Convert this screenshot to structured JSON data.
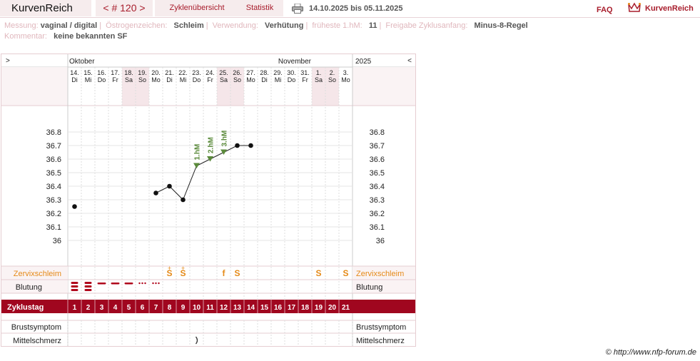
{
  "nav": {
    "brand": "KurvenReich",
    "cycle": "< # 120 >",
    "overview": "Zyklenübersicht",
    "stats": "Statistik",
    "date_range": "14.10.2025 bis 05.11.2025",
    "faq": "FAQ",
    "logo_text": "KurvenReich"
  },
  "info": {
    "messung_label": "Messung:",
    "messung": "vaginal / digital",
    "oestro_label": "Östrogenzeichen:",
    "oestro": "Schleim",
    "verwendung_label": "Verwendung:",
    "verwendung": "Verhütung",
    "frueh_label": "früheste 1.hM:",
    "frueh": "11",
    "freigabe_label": "Freigabe Zyklusanfang:",
    "freigabe": "Minus-8-Regel",
    "kommentar_label": "Kommentar:",
    "kommentar": "keine bekannten SF"
  },
  "chart": {
    "nav_left": ">",
    "nav_right": "<",
    "month1": "Oktober",
    "month2": "November",
    "year": "2025",
    "dates": [
      "14.",
      "15.",
      "16.",
      "17.",
      "18.",
      "19.",
      "20.",
      "21.",
      "22.",
      "23.",
      "24.",
      "25.",
      "26.",
      "27.",
      "28.",
      "29.",
      "30.",
      "31.",
      "1.",
      "2.",
      "3."
    ],
    "weekdays": [
      "Di",
      "Mi",
      "Do",
      "Fr",
      "Sa",
      "So",
      "Mo",
      "Di",
      "Mi",
      "Do",
      "Fr",
      "Sa",
      "So",
      "Mo",
      "Di",
      "Mi",
      "Do",
      "Fr",
      "Sa",
      "So",
      "Mo"
    ],
    "weekend_cols": [
      4,
      5,
      11,
      12,
      18,
      19
    ],
    "y_ticks": [
      "36.8",
      "36.7",
      "36.6",
      "36.5",
      "36.4",
      "36.3",
      "36.2",
      "36.1",
      "36"
    ],
    "temps": [
      36.25,
      null,
      null,
      null,
      null,
      null,
      36.35,
      36.4,
      36.3,
      36.55,
      36.6,
      36.65,
      36.7,
      36.7,
      null,
      null,
      null,
      null,
      null,
      null,
      null
    ],
    "line_segments": [
      [
        6,
        13
      ]
    ],
    "hm_markers": [
      {
        "day": 10,
        "label": "1.hM"
      },
      {
        "day": 11,
        "label": "2.hM"
      },
      {
        "day": 12,
        "label": "3.hM"
      }
    ],
    "schleim_label": "Zervixschleim",
    "schleim": [
      "",
      "",
      "",
      "",
      "",
      "",
      "",
      "S+",
      "S+",
      "",
      "",
      "f",
      "S",
      "",
      "",
      "",
      "",
      "",
      "S",
      "",
      "S"
    ],
    "blutung_label": "Blutung",
    "blutung": [
      "heavy",
      "heavy",
      "medium",
      "medium",
      "medium",
      "light",
      "light",
      "",
      "",
      "",
      "",
      "",
      "",
      "",
      "",
      "",
      "",
      "",
      "",
      "",
      ""
    ],
    "zyklustag_label": "Zyklustag",
    "zyklustage": [
      "1",
      "2",
      "3",
      "4",
      "5",
      "6",
      "7",
      "8",
      "9",
      "10",
      "11",
      "12",
      "13",
      "14",
      "15",
      "16",
      "17",
      "18",
      "19",
      "20",
      "21"
    ],
    "brust_label": "Brustsymptom",
    "mittel_label": "Mittelschmerz",
    "mittelschmerz": [
      "",
      "",
      "",
      "",
      "",
      "",
      "",
      "",
      "",
      "left",
      "",
      "",
      "",
      "",
      "",
      "",
      "",
      "",
      "",
      "",
      ""
    ],
    "colors": {
      "accent": "#a0061f",
      "schleim": "#e58a18",
      "hm": "#5a8a3a",
      "weekend": "#f5e6e9",
      "grid": "#dddddd"
    }
  },
  "copyright": "© http://www.nfp-forum.de"
}
